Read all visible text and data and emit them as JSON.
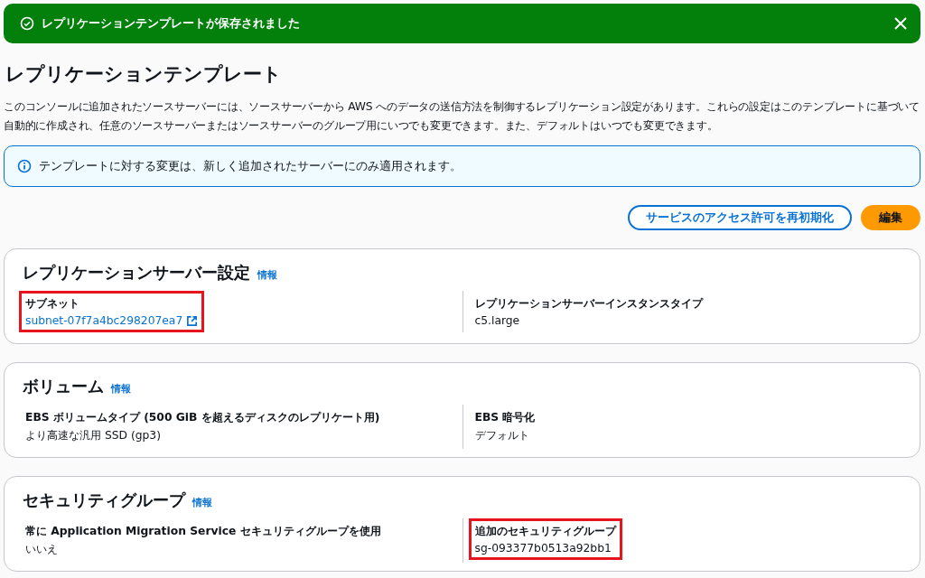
{
  "flash": {
    "message": "レプリケーションテンプレートが保存されました"
  },
  "title": "レプリケーションテンプレート",
  "description": "このコンソールに追加されたソースサーバーには、ソースサーバーから AWS へのデータの送信方法を制御するレプリケーション設定があります。これらの設定はこのテンプレートに基づいて自動的に作成され、任意のソースサーバーまたはソースサーバーのグループ用にいつでも変更できます。また、デフォルトはいつでも変更できます。",
  "info_alert": "テンプレートに対する変更は、新しく追加されたサーバーにのみ適用されます。",
  "buttons": [
    {
      "label": "サービスのアクセス許可を再初期化",
      "kind": "secondary"
    },
    {
      "label": "編集",
      "kind": "primary"
    }
  ],
  "sections": [
    {
      "title": "レプリケーションサーバー設定",
      "info": "情報",
      "fields": [
        {
          "label": "サブネット",
          "value": "subnet-07f7a4bc298207ea7",
          "kind": "link",
          "highlighted": true
        },
        {
          "label": "レプリケーションサーバーインスタンスタイプ",
          "value": "c5.large",
          "kind": "text",
          "highlighted": false
        }
      ]
    },
    {
      "title": "ボリューム",
      "info": "情報",
      "fields": [
        {
          "label": "EBS ボリュームタイプ (500 GiB を超えるディスクのレプリケート用)",
          "value": "より高速な汎用 SSD (gp3)",
          "kind": "text",
          "highlighted": false
        },
        {
          "label": "EBS 暗号化",
          "value": "デフォルト",
          "kind": "text",
          "highlighted": false
        }
      ]
    },
    {
      "title": "セキュリティグループ",
      "info": "情報",
      "fields": [
        {
          "label": "常に Application Migration Service セキュリティグループを使用",
          "value": "いいえ",
          "kind": "text",
          "highlighted": false
        },
        {
          "label": "追加のセキュリティグループ",
          "value": "sg-093377b0513a92bb1",
          "kind": "text",
          "highlighted": true
        }
      ]
    }
  ]
}
